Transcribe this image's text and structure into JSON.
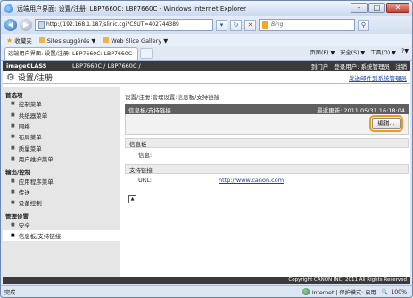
{
  "window": {
    "title": "远端用户界面: 设置/注册: LBP7660C: LBP7660C - Windows Internet Explorer",
    "min": "–",
    "max": "□",
    "close": "✕"
  },
  "address": {
    "url": "http://192.168.1.187/slinic.cgi?CSUT=402744389",
    "search_placeholder": "Bing"
  },
  "favorites": {
    "label": "收藏夹",
    "items": [
      "Sites suggérés ▼",
      "Web Slice Gallery ▼"
    ]
  },
  "tab": {
    "label": "远端用户界面: 设置/注册: LBP7660C: LBP7660C"
  },
  "commands": [
    "页面(P) ▼",
    "安全(S) ▼",
    "工具(O) ▼",
    "?▼"
  ],
  "app": {
    "brand": "imageCLASS",
    "model": "LBP7660C / LBP7660C /",
    "portal": "到门户",
    "user": "登录用户: 系统管理员",
    "logout": "注销",
    "page_title": "设置/注册",
    "send_link": "发送邮件到系统管理员"
  },
  "sidebar": {
    "groups": [
      {
        "title": "首选项",
        "items": [
          "控制菜单",
          "共纸器菜单",
          "网络",
          "布局菜单",
          "质量菜单",
          "用户维护菜单"
        ]
      },
      {
        "title": "输出/控制",
        "items": [
          "应用程序菜单",
          "传送",
          "设备控制"
        ]
      },
      {
        "title": "管理设置",
        "items": [
          "安全",
          "信息板/支持链接"
        ]
      }
    ]
  },
  "main": {
    "breadcrumb": "设置/注册:管理设置:信息板/支持链接",
    "panel_title": "信息板/支持链接",
    "last_updated": "最近更新: 2011 05/31 16:18:04",
    "edit_button": "编辑...",
    "info_section": "信息板",
    "info_label": "信息:",
    "info_value": "",
    "support_section": "支持链接",
    "url_label": "URL:",
    "url_value": "http://www.canon.com"
  },
  "footer": "Copyright CANON INC. 2011 All Rights Reserved",
  "status": {
    "left": "完成",
    "zone": "Internet | 保护模式: 启用",
    "zoom": "100%"
  }
}
